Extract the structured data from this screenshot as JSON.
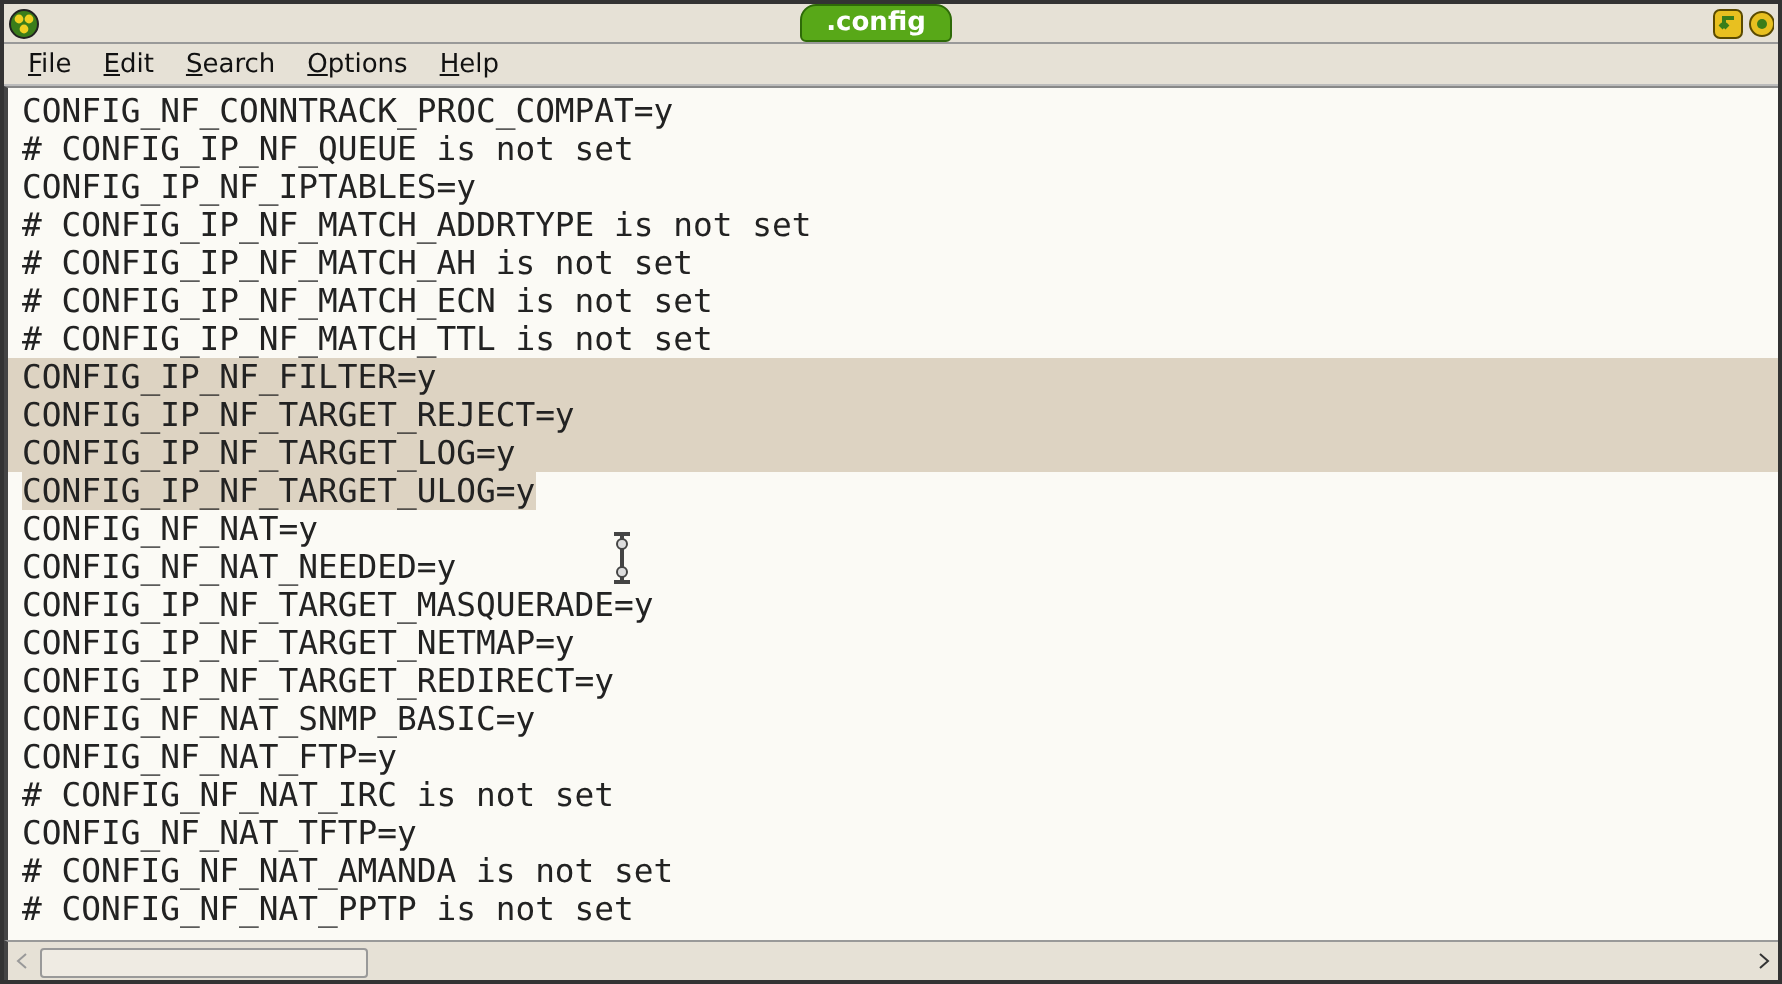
{
  "window": {
    "title": ".config"
  },
  "menu": [
    {
      "label": "File"
    },
    {
      "label": "Edit"
    },
    {
      "label": "Search"
    },
    {
      "label": "Options"
    },
    {
      "label": "Help"
    }
  ],
  "lines": [
    {
      "text": "CONFIG_NF_CONNTRACK_PROC_COMPAT=y",
      "selected": false
    },
    {
      "text": "# CONFIG_IP_NF_QUEUE is not set",
      "selected": false
    },
    {
      "text": "CONFIG_IP_NF_IPTABLES=y",
      "selected": false
    },
    {
      "text": "# CONFIG_IP_NF_MATCH_ADDRTYPE is not set",
      "selected": false
    },
    {
      "text": "# CONFIG_IP_NF_MATCH_AH is not set",
      "selected": false
    },
    {
      "text": "# CONFIG_IP_NF_MATCH_ECN is not set",
      "selected": false
    },
    {
      "text": "# CONFIG_IP_NF_MATCH_TTL is not set",
      "selected": false
    },
    {
      "text": "CONFIG_IP_NF_FILTER=y",
      "selected": true
    },
    {
      "text": "CONFIG_IP_NF_TARGET_REJECT=y",
      "selected": true
    },
    {
      "text": "CONFIG_IP_NF_TARGET_LOG=y",
      "selected": true
    },
    {
      "text": "CONFIG_IP_NF_TARGET_ULOG=y",
      "selected": true
    },
    {
      "text": "CONFIG_NF_NAT=y",
      "selected": false
    },
    {
      "text": "CONFIG_NF_NAT_NEEDED=y",
      "selected": false
    },
    {
      "text": "CONFIG_IP_NF_TARGET_MASQUERADE=y",
      "selected": false
    },
    {
      "text": "CONFIG_IP_NF_TARGET_NETMAP=y",
      "selected": false
    },
    {
      "text": "CONFIG_IP_NF_TARGET_REDIRECT=y",
      "selected": false
    },
    {
      "text": "CONFIG_NF_NAT_SNMP_BASIC=y",
      "selected": false
    },
    {
      "text": "CONFIG_NF_NAT_FTP=y",
      "selected": false
    },
    {
      "text": "# CONFIG_NF_NAT_IRC is not set",
      "selected": false
    },
    {
      "text": "CONFIG_NF_NAT_TFTP=y",
      "selected": false
    },
    {
      "text": "# CONFIG_NF_NAT_AMANDA is not set",
      "selected": false
    },
    {
      "text": "# CONFIG_NF_NAT_PPTP is not set",
      "selected": false
    }
  ]
}
